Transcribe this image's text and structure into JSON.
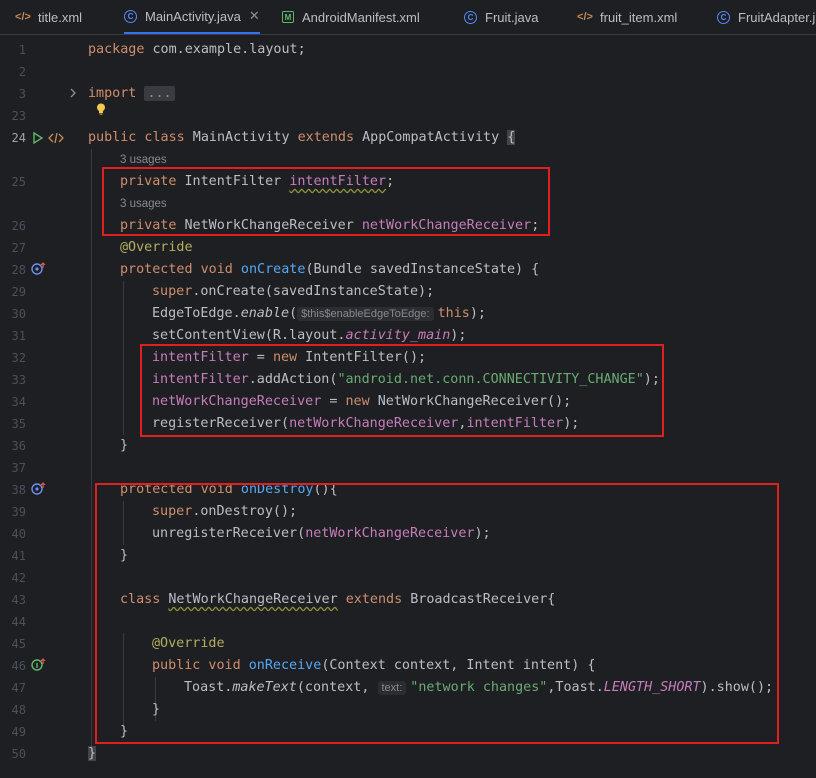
{
  "tabs": [
    {
      "label": "title.xml",
      "icon": "xml-file-icon",
      "active": false
    },
    {
      "label": "MainActivity.java",
      "icon": "java-class-icon",
      "active": true
    },
    {
      "label": "AndroidManifest.xml",
      "icon": "manifest-file-icon",
      "active": false
    },
    {
      "label": "Fruit.java",
      "icon": "java-class-icon",
      "active": false
    },
    {
      "label": "fruit_item.xml",
      "icon": "xml-file-icon",
      "active": false
    },
    {
      "label": "FruitAdapter.j",
      "icon": "java-class-icon",
      "active": false
    }
  ],
  "close_glyph": "✕",
  "line_numbers": [
    "1",
    "2",
    "3",
    "23",
    "24",
    "25",
    "26",
    "27",
    "28",
    "29",
    "30",
    "31",
    "32",
    "33",
    "34",
    "35",
    "36",
    "37",
    "38",
    "39",
    "40",
    "41",
    "42",
    "43",
    "44",
    "45",
    "46",
    "47",
    "48",
    "49",
    "50"
  ],
  "code": {
    "l1_kw": "package",
    "l1_rest": " com.example.layout;",
    "l3_kw": "import",
    "l3_fold": "...",
    "l24_kw": "public class",
    "l24_name": " MainActivity ",
    "l24_ext": "extends",
    "l24_super": " AppCompatActivity ",
    "l24_brace": "{",
    "usages1": "3 usages",
    "l25_kw": "private",
    "l25_type": " IntentFilter ",
    "l25_field": "intentFilter",
    "l25_end": ";",
    "usages2": "3 usages",
    "l26_kw": "private",
    "l26_type": " NetWorkChangeReceiver ",
    "l26_field": "netWorkChangeReceiver",
    "l26_end": ";",
    "l27_ann": "@Override",
    "l28_kw": "protected void",
    "l28_fn": " onCreate",
    "l28_rest": "(Bundle savedInstanceState) {",
    "l29_kw": "super",
    "l29_rest": ".onCreate(savedInstanceState);",
    "l30_a": "EdgeToEdge.",
    "l30_fn": "enable",
    "l30_b": "(",
    "l30_hint": "$this$enableEdgeToEdge:",
    "l30_kw": "this",
    "l30_c": ");",
    "l31_a": "setContentView(R.layout.",
    "l31_fld": "activity_main",
    "l31_b": ");",
    "l32_fld": "intentFilter",
    "l32_a": " = ",
    "l32_kw": "new",
    "l32_b": " IntentFilter();",
    "l33_fld": "intentFilter",
    "l33_a": ".addAction(",
    "l33_str": "\"android.net.conn.CONNECTIVITY_CHANGE\"",
    "l33_b": ");",
    "l34_fld": "netWorkChangeReceiver",
    "l34_a": " = ",
    "l34_kw": "new",
    "l34_b": " NetWorkChangeReceiver();",
    "l35_a": "registerReceiver(",
    "l35_f1": "netWorkChangeReceiver",
    "l35_comma": ",",
    "l35_f2": "intentFilter",
    "l35_b": ");",
    "l36": "}",
    "l38_kw": "protected void",
    "l38_fn": " onDestroy",
    "l38_rest": "(){",
    "l39_kw": "super",
    "l39_rest": ".onDestroy();",
    "l40_a": "unregisterReceiver(",
    "l40_fld": "netWorkChangeReceiver",
    "l40_b": ");",
    "l41": "}",
    "l43_kw": "class",
    "l43_name": "NetWorkChangeReceiver",
    "l43_ext": "extends",
    "l43_super": " BroadcastReceiver{",
    "l45_ann": "@Override",
    "l46_kw": "public void",
    "l46_fn": " onReceive",
    "l46_rest": "(Context context, Intent intent) {",
    "l47_a": "Toast.",
    "l47_fn": "makeText",
    "l47_b": "(context, ",
    "l47_hint": "text:",
    "l47_str": "\"network changes\"",
    "l47_c": ",Toast.",
    "l47_fld": "LENGTH_SHORT",
    "l47_d": ").show();",
    "l48": "}",
    "l49": "}",
    "l50": "}"
  },
  "colors": {
    "highlight_box": "#e0201e",
    "keyword": "#cf8e6d",
    "field": "#c77dbb",
    "function": "#56a8f5",
    "string": "#6aab73",
    "annotation": "#b3ae60"
  }
}
